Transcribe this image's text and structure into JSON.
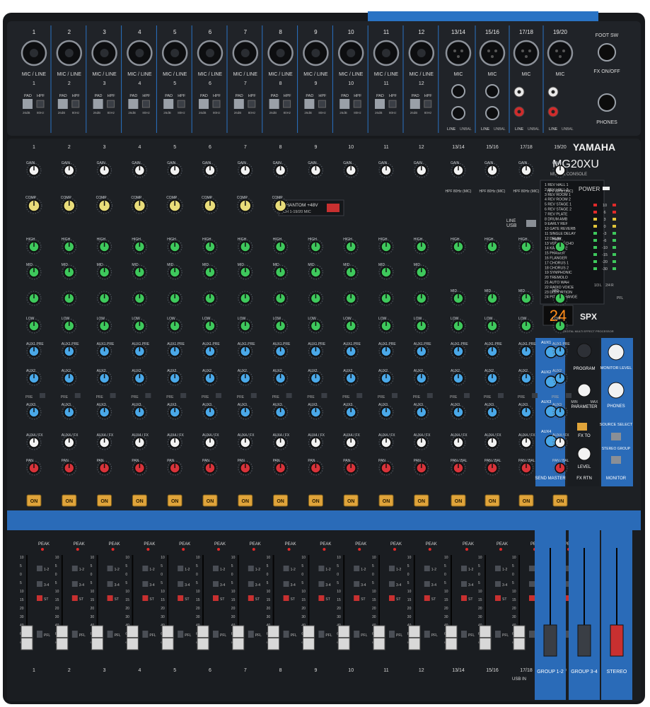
{
  "brand": "YAMAHA",
  "model": "MG20XU",
  "subtitle": "MIXING CONSOLE",
  "mono_channels": [
    "1",
    "2",
    "3",
    "4",
    "5",
    "6",
    "7",
    "8",
    "9",
    "10",
    "11",
    "12"
  ],
  "stereo_channels": [
    "13/14",
    "15/16",
    "17/18",
    "19/20"
  ],
  "input_labels": {
    "mic_line": "MIC / LINE",
    "mic": "MIC",
    "pad": "PAD",
    "pad_value": "26dB",
    "hpf": "HPF",
    "hpf_value": "80Hz",
    "line": "LINE",
    "unbal": "UNBAL",
    "mono": "MONO",
    "foot_sw": "FOOT SW",
    "fx_on_off": "FX ON/OFF",
    "phones": "PHONES"
  },
  "strip_labels": {
    "gain": "GAIN",
    "comp": "COMP",
    "high": "HIGH",
    "high_freq": "10kHz",
    "mid": "MID",
    "mid_freq": "2.5kHz",
    "low": "LOW",
    "low_freq": "100Hz",
    "aux1": "AUX1 PRE",
    "aux2": "AUX2",
    "aux3": "AUX3",
    "aux4": "AUX4 / FX",
    "pre": "PRE",
    "pan": "PAN",
    "pan_bal": "PAN / BAL",
    "on": "ON",
    "peak": "PEAK",
    "pfl": "PFL",
    "bus_12": "1-2",
    "bus_34": "3-4",
    "bus_st": "ST",
    "hpf_mic": "HPF 80Hz (MIC)"
  },
  "fader_scale": [
    "10",
    "5",
    "0",
    "5",
    "10",
    "15",
    "20",
    "30",
    "40",
    "60",
    "∞"
  ],
  "phantom": {
    "label": "PHANTOM +48V",
    "sub": "CH 1-19/20 MIC"
  },
  "usb": {
    "label": "USB",
    "line": "LINE",
    "usb_in": "USB IN"
  },
  "fx_programs": [
    "REV HALL 1",
    "REV HALL 2",
    "REV ROOM 1",
    "REV ROOM 2",
    "REV STAGE 1",
    "REV STAGE 2",
    "REV PLATE",
    "DRUM AMB",
    "EARLY REF",
    "GATE REVERB",
    "SINGLE DELAY",
    "DELAY",
    "VOCAL ECHO",
    "KARAOKE",
    "PHASER",
    "FLANGER",
    "CHORUS 1",
    "CHORUS 2",
    "SYMPHONIC",
    "TREMOLO",
    "AUTO WAH",
    "RADIO VOICE",
    "DISTORTION",
    "PITCH CHANGE"
  ],
  "fx_display": "24",
  "spx_label": "SPX",
  "spx_sub": "DIGITAL MULTI EFFECT PROCESSOR",
  "power": "POWER",
  "meter_scale": [
    "10",
    "6",
    "3",
    "0",
    "-3",
    "-6",
    "-10",
    "-15",
    "-20",
    "-30"
  ],
  "meter_sub": [
    "1/3",
    "L",
    "2/4",
    "R",
    "PFL"
  ],
  "master_section": {
    "send_master": "SEND MASTER",
    "program": "PROGRAM",
    "parameter": "PARAMETER",
    "param_min": "MIN",
    "param_max": "MAX",
    "fx_to": "FX TO",
    "level": "LEVEL",
    "fx_rtn": "FX RTN",
    "monitor_level": "MONITOR LEVEL",
    "phones": "PHONES",
    "source_select": "SOURCE SELECT",
    "stereo_group": "STEREO GROUP",
    "monitor": "MONITOR",
    "aux_labels": [
      "AUX1",
      "AUX2",
      "AUX3",
      "AUX4"
    ]
  },
  "master_faders": [
    "GROUP 1-2",
    "GROUP 3-4",
    "STEREO"
  ],
  "colors": {
    "body": "#1c1e22",
    "panel": "#22262c",
    "blue": "#2a73c4",
    "knob_white": "#f2f2f2",
    "knob_yellow": "#e8dc7a",
    "knob_green": "#3ec85c",
    "knob_blue": "#4aa8e8",
    "knob_red": "#d8333a",
    "on_button": "#e0a43a",
    "led_red": "#e02a2a",
    "display_orange": "#ff8c1a"
  }
}
